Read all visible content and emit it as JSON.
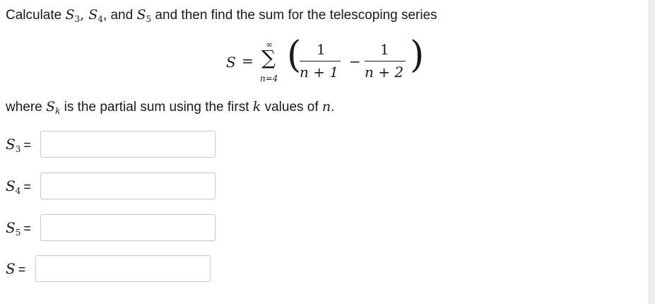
{
  "prompt": {
    "text_1": "Calculate ",
    "s3": "S",
    "s3_sub": "3",
    "comma_1": ", ",
    "s4": "S",
    "s4_sub": "4",
    "text_2": ", and ",
    "s5": "S",
    "s5_sub": "5",
    "text_3": " and then find the sum for the telescoping series"
  },
  "formula": {
    "lhs": "S",
    "equals": "=",
    "sigma": "∑",
    "upper": "∞",
    "lower": "n=4",
    "left_paren": "(",
    "num_1": "1",
    "den_1": "n + 1",
    "minus": "−",
    "num_2": "1",
    "den_2": "n + 2",
    "right_paren": ")"
  },
  "where": {
    "text_1": "where ",
    "sk": "S",
    "sk_sub": "k",
    "text_2": " is the partial sum using the first ",
    "k": "k",
    "text_3": " values of ",
    "n": "n",
    "text_4": "."
  },
  "answers": [
    {
      "var": "S",
      "sub": "3",
      "eq": "=",
      "value": ""
    },
    {
      "var": "S",
      "sub": "4",
      "eq": "=",
      "value": ""
    },
    {
      "var": "S",
      "sub": "5",
      "eq": "=",
      "value": ""
    },
    {
      "var": "S",
      "sub": "",
      "eq": "=",
      "value": ""
    }
  ]
}
